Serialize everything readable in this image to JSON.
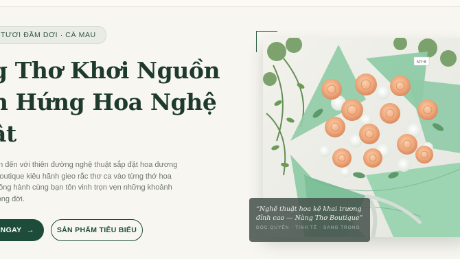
{
  "hero": {
    "badge": "TƯƠI ĐẦM DƠI · CÀ MAU",
    "headline": [
      "g Thơ Khơi Nguồn",
      "n Hứng Hoa Nghệ",
      "ật"
    ],
    "description": [
      "an đến với thiên đường nghệ thuật sắp đặt hoa đương",
      "Boutique kiêu hãnh gieo rắc thơ ca vào từng thớ hoa",
      "đồng hành cùng bạn tôn vinh trọn vẹn những khoảnh",
      "rong đời."
    ],
    "primary_button": "ANGAY",
    "primary_button_text": "ANGAY",
    "secondary_button": "SẢN PHẨM TIÊU BIỂU"
  },
  "quote": {
    "text": "“Nghệ thuật hoa kệ khai trương\nđỉnh cao — Nàng Thơ Boutique”",
    "tags": "ĐỘC QUYỀN · TINH TẾ · SANG TRỌNG"
  },
  "photo": {
    "card_label": "NT·B"
  },
  "colors": {
    "background": "#f8f6f1",
    "primary_green": "#1d4d3a",
    "heading": "#1e3a2d",
    "mint_wrap": "#8fcba6",
    "rose_peach": "#f0b285"
  },
  "icons": {
    "primary_button_icon": "arrow-right-icon"
  }
}
